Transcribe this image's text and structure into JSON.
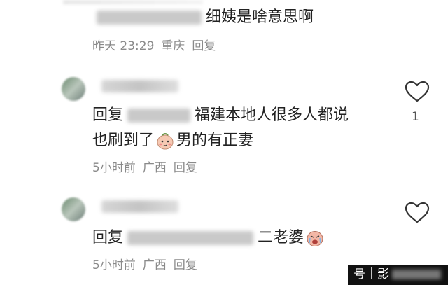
{
  "comments": [
    {
      "reply_text": "细姨是啥意思啊",
      "meta": {
        "time": "昨天 23:29",
        "location": "重庆",
        "reply_label": "回复"
      }
    },
    {
      "reply_prefix": "回复",
      "text_line1": "福建本地人很多人都说",
      "text_line2_a": "也刷到了",
      "text_line2_b": "男的有正妻",
      "like_count": "1",
      "meta": {
        "time": "5小时前",
        "location": "广西",
        "reply_label": "回复"
      }
    },
    {
      "reply_prefix": "回复",
      "text": "二老婆",
      "meta": {
        "time": "5小时前",
        "location": "广西",
        "reply_label": "回复"
      }
    }
  ],
  "watermark": {
    "text": "号｜影"
  },
  "icons": {
    "heart": "heart-outline-icon",
    "emoji_blush": "blushing-face-emoji-icon",
    "emoji_cry": "crying-face-emoji-icon"
  },
  "colors": {
    "text": "#222222",
    "meta": "#8a8a8a",
    "watermark_bg": "#111111"
  }
}
